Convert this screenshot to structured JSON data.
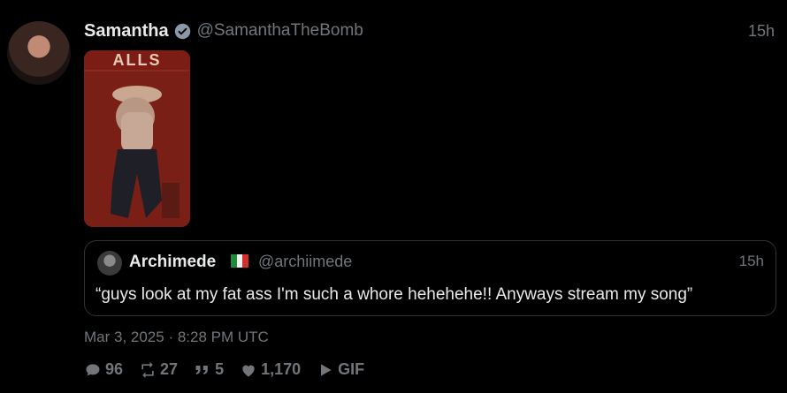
{
  "tweet": {
    "author_name": "Samantha",
    "handle": "@SamanthaTheBomb",
    "time": "15h",
    "media_banner_text": "ALLS",
    "date": "Mar 3, 2025 · 8:28 PM UTC"
  },
  "quote": {
    "author_name": "Archimede",
    "flag": "italy-flag",
    "handle": "@archiimede",
    "time": "15h",
    "text": "“guys look at my fat ass I'm such a whore hehehehe!! Anyways stream my song”"
  },
  "actions": {
    "replies": "96",
    "retweets": "27",
    "quotes": "5",
    "likes": "1,170",
    "gif_label": "GIF"
  },
  "colors": {
    "background": "#000000",
    "text": "#e7e9ea",
    "muted": "#71767b",
    "border": "#2f3336",
    "verified": "#8b98a5"
  }
}
